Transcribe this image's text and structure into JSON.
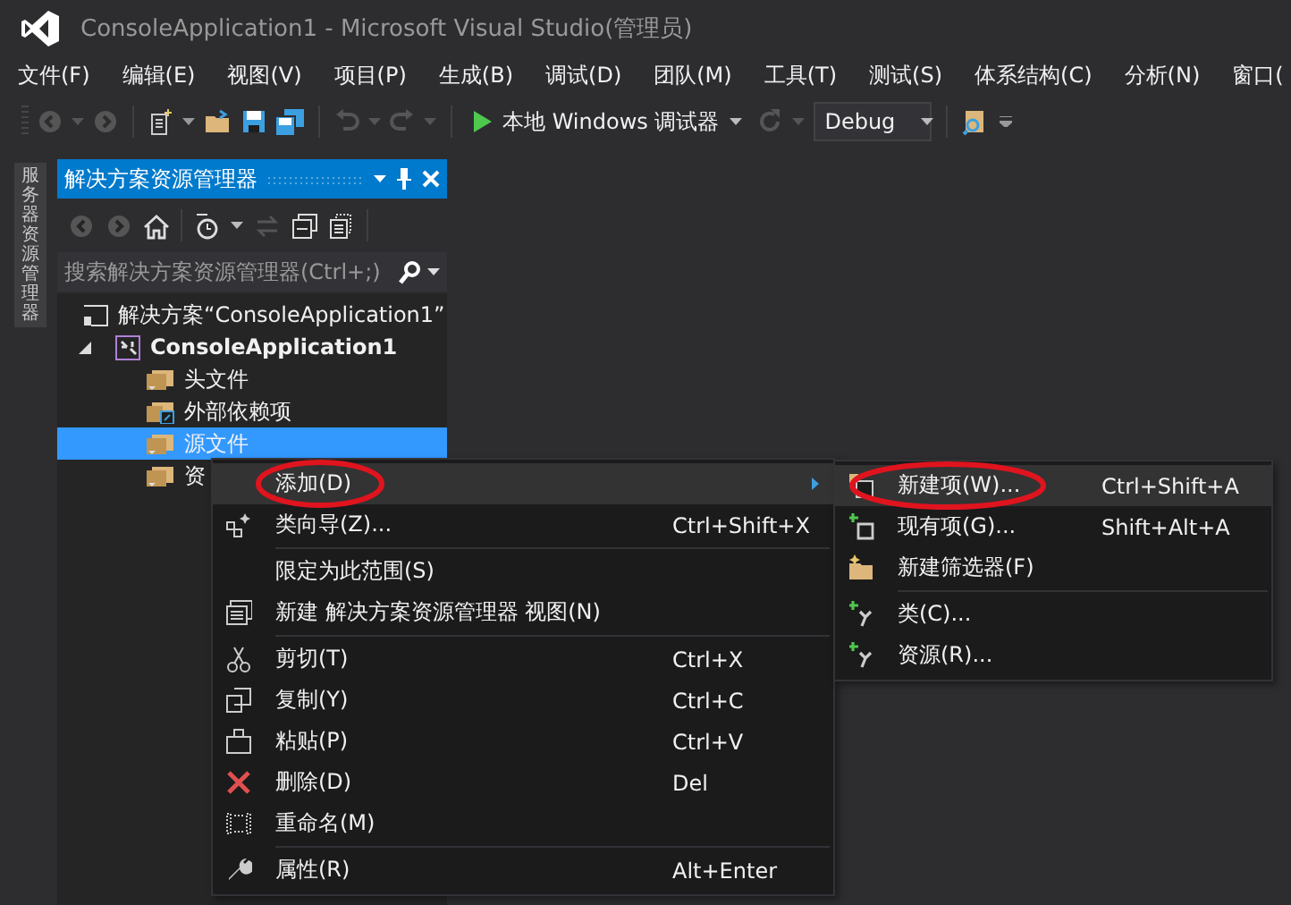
{
  "window": {
    "title": "ConsoleApplication1 - Microsoft Visual Studio(管理员)"
  },
  "menu_bar": [
    "文件(F)",
    "编辑(E)",
    "视图(V)",
    "项目(P)",
    "生成(B)",
    "调试(D)",
    "团队(M)",
    "工具(T)",
    "测试(S)",
    "体系结构(C)",
    "分析(N)",
    "窗口("
  ],
  "toolbar": {
    "run_target": "本地 Windows 调试器",
    "configuration": "Debug"
  },
  "side_tab": {
    "label": "服务器资源管理器"
  },
  "solution_explorer": {
    "title": "解决方案资源管理器",
    "search": {
      "placeholder": "搜索解决方案资源管理器(Ctrl+;)"
    },
    "tree": [
      {
        "label": "解决方案“ConsoleApplication1”",
        "kind": "solution",
        "children": [
          {
            "label": "ConsoleApplication1",
            "kind": "project",
            "expanded": true,
            "children": [
              {
                "label": "头文件",
                "kind": "folder",
                "selected": false
              },
              {
                "label": "外部依赖项",
                "kind": "deps",
                "selected": false
              },
              {
                "label": "源文件",
                "kind": "folder",
                "selected": true
              },
              {
                "label": "资",
                "kind": "folder",
                "selected": false
              }
            ]
          }
        ]
      }
    ]
  },
  "context_menu": {
    "items": [
      {
        "kind": "item",
        "label": "添加(D)",
        "submenu": true,
        "highlighted": true,
        "circled": true
      },
      {
        "kind": "item",
        "label": "类向导(Z)...",
        "shortcut": "Ctrl+Shift+X",
        "highlighted": false,
        "circled": false
      },
      {
        "kind": "separator"
      },
      {
        "kind": "item",
        "label": "限定为此范围(S)",
        "highlighted": false,
        "circled": false
      },
      {
        "kind": "item",
        "label": "新建 解决方案资源管理器 视图(N)",
        "highlighted": false,
        "circled": false
      },
      {
        "kind": "separator"
      },
      {
        "kind": "item",
        "label": "剪切(T)",
        "shortcut": "Ctrl+X",
        "highlighted": false,
        "circled": false
      },
      {
        "kind": "item",
        "label": "复制(Y)",
        "shortcut": "Ctrl+C",
        "highlighted": false,
        "circled": false
      },
      {
        "kind": "item",
        "label": "粘贴(P)",
        "shortcut": "Ctrl+V",
        "highlighted": false,
        "circled": false
      },
      {
        "kind": "item",
        "label": "删除(D)",
        "shortcut": "Del",
        "highlighted": false,
        "circled": false
      },
      {
        "kind": "item",
        "label": "重命名(M)",
        "highlighted": false,
        "circled": false
      },
      {
        "kind": "separator"
      },
      {
        "kind": "item",
        "label": "属性(R)",
        "shortcut": "Alt+Enter",
        "highlighted": false,
        "circled": false
      }
    ]
  },
  "submenu": {
    "items": [
      {
        "kind": "item",
        "label": "新建项(W)...",
        "shortcut": "Ctrl+Shift+A",
        "highlighted": true,
        "circled": true
      },
      {
        "kind": "item",
        "label": "现有项(G)...",
        "shortcut": "Shift+Alt+A",
        "highlighted": false,
        "circled": false
      },
      {
        "kind": "item",
        "label": "新建筛选器(F)",
        "highlighted": false,
        "circled": false
      },
      {
        "kind": "separator"
      },
      {
        "kind": "item",
        "label": "类(C)...",
        "highlighted": false,
        "circled": false
      },
      {
        "kind": "item",
        "label": "资源(R)...",
        "highlighted": false,
        "circled": false
      }
    ]
  }
}
